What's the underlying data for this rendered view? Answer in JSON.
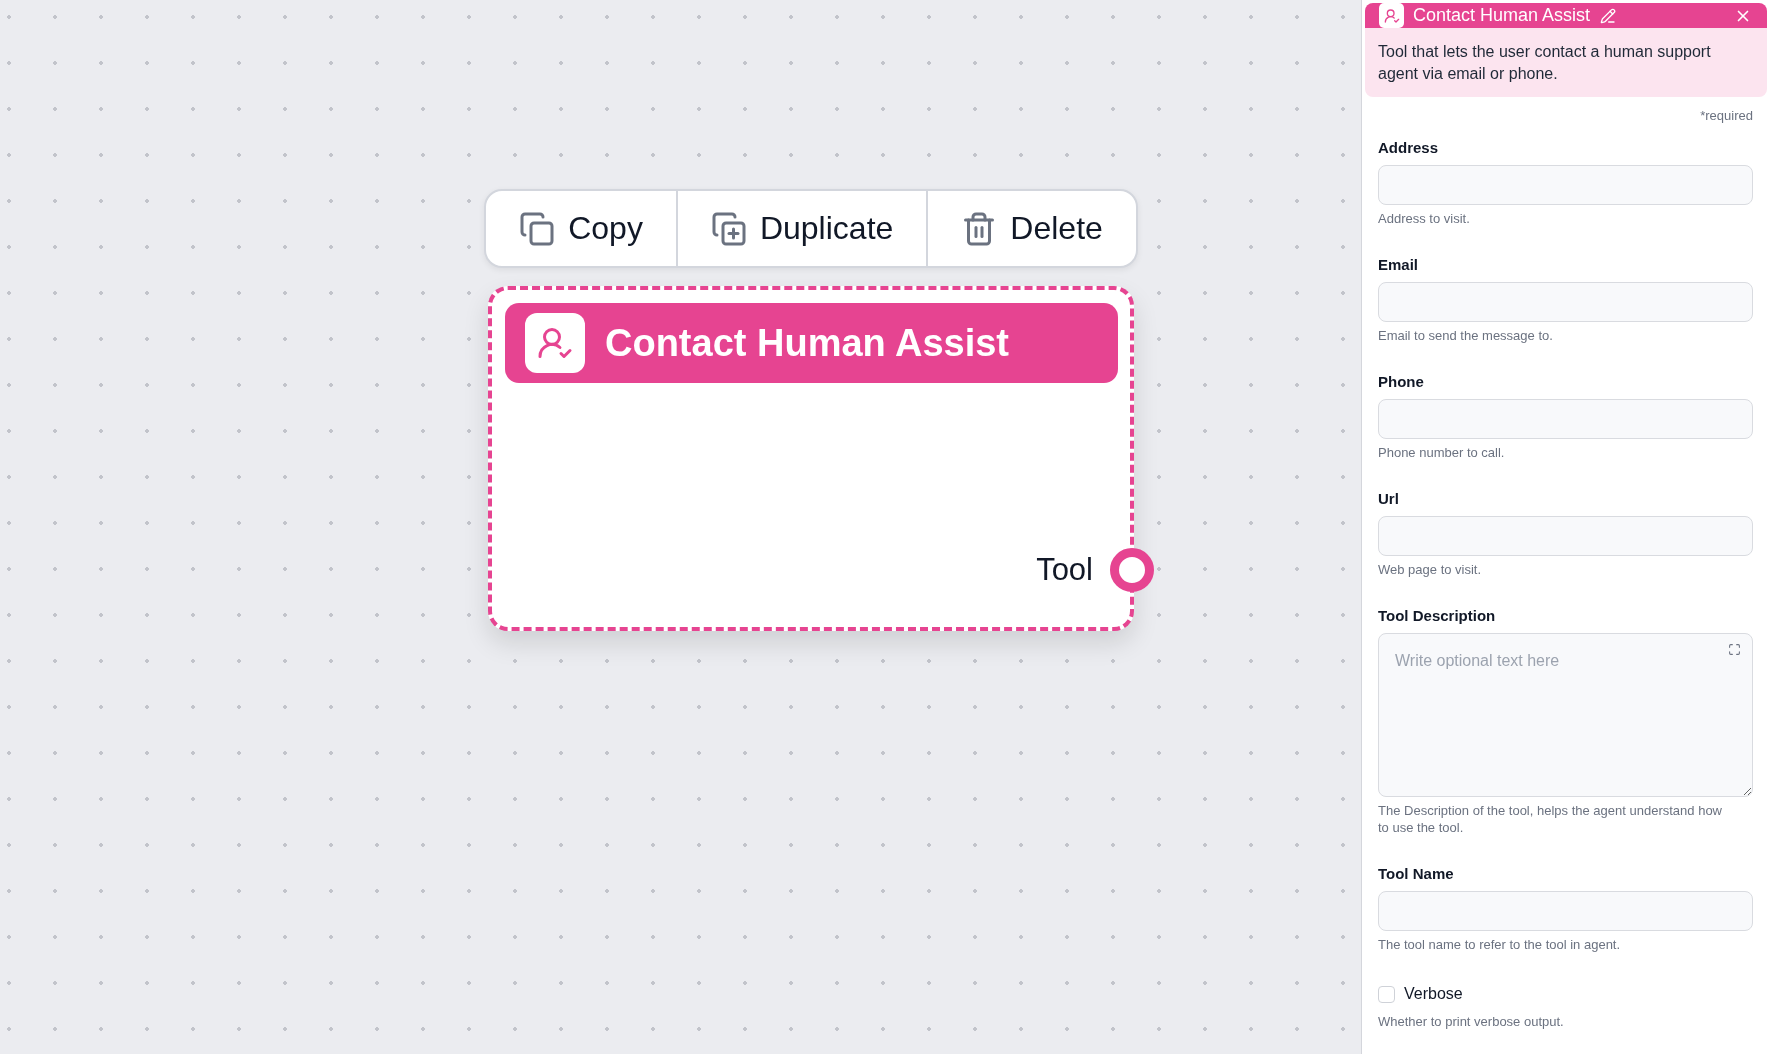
{
  "canvas": {
    "node_toolbar": {
      "buttons": [
        {
          "kind": "copy",
          "label": "Copy"
        },
        {
          "kind": "duplicate",
          "label": "Duplicate"
        },
        {
          "kind": "delete",
          "label": "Delete"
        }
      ]
    },
    "node": {
      "title": "Contact Human Assist",
      "selected": true,
      "outputs": [
        {
          "label": "Tool"
        }
      ]
    }
  },
  "properties_panel": {
    "title": "Contact Human Assist",
    "description": "Tool that lets the user contact a human support agent via email or phone.",
    "required_note": "*required",
    "fields": [
      {
        "kind": "input",
        "label": "Address",
        "help": "Address to visit."
      },
      {
        "kind": "input",
        "label": "Email",
        "help": "Email to send the message to."
      },
      {
        "kind": "input",
        "label": "Phone",
        "help": "Phone number to call."
      },
      {
        "kind": "input",
        "label": "Url",
        "help": "Web page to visit."
      },
      {
        "kind": "textarea",
        "label": "Tool Description",
        "placeholder": "Write optional text here",
        "help": "The Description of the tool, helps the agent understand how to use the tool."
      },
      {
        "kind": "input",
        "label": "Tool Name",
        "help": "The tool name to refer to the tool in agent."
      },
      {
        "kind": "checkbox",
        "label": "Verbose",
        "checked": false,
        "help": "Whether to print verbose output."
      }
    ]
  }
}
